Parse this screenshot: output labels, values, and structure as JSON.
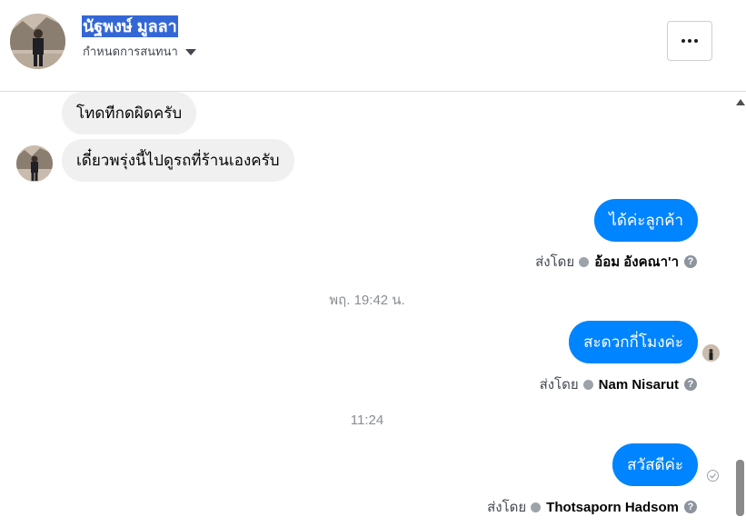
{
  "header": {
    "contact_name": "นัฐพงษ์ มูลลา",
    "conversation_settings": "กำหนดการสนทนา",
    "more_button_icon": "more-horizontal-icon"
  },
  "messages": [
    {
      "direction": "incoming",
      "text": "โทดทีกดผิดครับ"
    },
    {
      "direction": "incoming",
      "text": "เดี๋ยวพรุ่งนี้ไปดูรถที่ร้านเองครับ"
    },
    {
      "direction": "outgoing",
      "text": "ได้ค่ะลูกค้า",
      "sent_by_label": "ส่งโดย",
      "sender": "อ้อม อังคณา'า"
    },
    {
      "direction": "outgoing",
      "text": "สะดวกกี่โมงค่ะ",
      "sent_by_label": "ส่งโดย",
      "sender": "Nam Nisarut"
    },
    {
      "direction": "outgoing",
      "text": "สวัสดีค่ะ",
      "sent_by_label": "ส่งโดย",
      "sender": "Thotsaporn Hadsom"
    }
  ],
  "timestamps": [
    "พฤ. 19:42 น.",
    "11:24"
  ],
  "colors": {
    "outgoing_bubble": "#0084ff",
    "incoming_bubble": "#f0f0f0",
    "name_highlight": "#3367d6"
  }
}
